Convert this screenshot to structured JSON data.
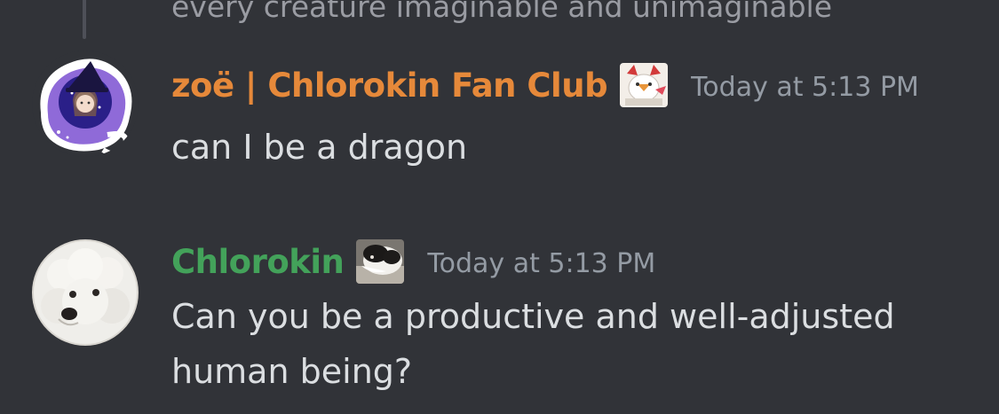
{
  "previous_message": {
    "text": "every creature imaginable and unimaginable"
  },
  "messages": [
    {
      "username": "zoë | Chlorokin Fan Club",
      "timestamp": "Today at 5:13 PM",
      "content": "can I be a dragon",
      "avatar_icon": "witch-avatar-icon",
      "role_icon": "cat-ears-role-icon",
      "name_color": "#e6893a"
    },
    {
      "username": "Chlorokin",
      "timestamp": "Today at 5:13 PM",
      "content": "Can you be a productive and well-adjusted human being?",
      "avatar_icon": "white-dog-avatar-icon",
      "role_icon": "guinea-pig-role-icon",
      "name_color": "#43a25a"
    }
  ],
  "colors": {
    "background": "#313338",
    "text": "#dbdee1",
    "muted": "#949ba4"
  }
}
